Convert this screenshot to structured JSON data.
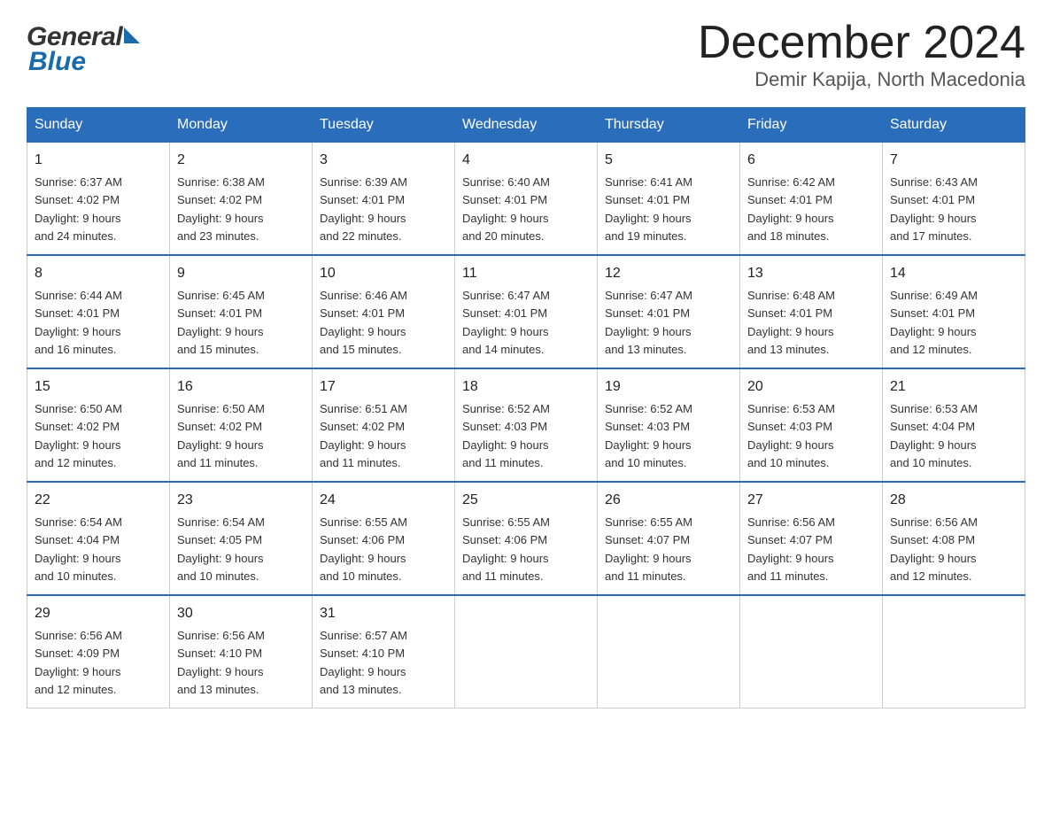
{
  "header": {
    "logo_general": "General",
    "logo_blue": "Blue",
    "month_year": "December 2024",
    "location": "Demir Kapija, North Macedonia"
  },
  "days_of_week": [
    "Sunday",
    "Monday",
    "Tuesday",
    "Wednesday",
    "Thursday",
    "Friday",
    "Saturday"
  ],
  "weeks": [
    [
      {
        "day": "1",
        "sunrise": "6:37 AM",
        "sunset": "4:02 PM",
        "daylight": "9 hours and 24 minutes."
      },
      {
        "day": "2",
        "sunrise": "6:38 AM",
        "sunset": "4:02 PM",
        "daylight": "9 hours and 23 minutes."
      },
      {
        "day": "3",
        "sunrise": "6:39 AM",
        "sunset": "4:01 PM",
        "daylight": "9 hours and 22 minutes."
      },
      {
        "day": "4",
        "sunrise": "6:40 AM",
        "sunset": "4:01 PM",
        "daylight": "9 hours and 20 minutes."
      },
      {
        "day": "5",
        "sunrise": "6:41 AM",
        "sunset": "4:01 PM",
        "daylight": "9 hours and 19 minutes."
      },
      {
        "day": "6",
        "sunrise": "6:42 AM",
        "sunset": "4:01 PM",
        "daylight": "9 hours and 18 minutes."
      },
      {
        "day": "7",
        "sunrise": "6:43 AM",
        "sunset": "4:01 PM",
        "daylight": "9 hours and 17 minutes."
      }
    ],
    [
      {
        "day": "8",
        "sunrise": "6:44 AM",
        "sunset": "4:01 PM",
        "daylight": "9 hours and 16 minutes."
      },
      {
        "day": "9",
        "sunrise": "6:45 AM",
        "sunset": "4:01 PM",
        "daylight": "9 hours and 15 minutes."
      },
      {
        "day": "10",
        "sunrise": "6:46 AM",
        "sunset": "4:01 PM",
        "daylight": "9 hours and 15 minutes."
      },
      {
        "day": "11",
        "sunrise": "6:47 AM",
        "sunset": "4:01 PM",
        "daylight": "9 hours and 14 minutes."
      },
      {
        "day": "12",
        "sunrise": "6:47 AM",
        "sunset": "4:01 PM",
        "daylight": "9 hours and 13 minutes."
      },
      {
        "day": "13",
        "sunrise": "6:48 AM",
        "sunset": "4:01 PM",
        "daylight": "9 hours and 13 minutes."
      },
      {
        "day": "14",
        "sunrise": "6:49 AM",
        "sunset": "4:01 PM",
        "daylight": "9 hours and 12 minutes."
      }
    ],
    [
      {
        "day": "15",
        "sunrise": "6:50 AM",
        "sunset": "4:02 PM",
        "daylight": "9 hours and 12 minutes."
      },
      {
        "day": "16",
        "sunrise": "6:50 AM",
        "sunset": "4:02 PM",
        "daylight": "9 hours and 11 minutes."
      },
      {
        "day": "17",
        "sunrise": "6:51 AM",
        "sunset": "4:02 PM",
        "daylight": "9 hours and 11 minutes."
      },
      {
        "day": "18",
        "sunrise": "6:52 AM",
        "sunset": "4:03 PM",
        "daylight": "9 hours and 11 minutes."
      },
      {
        "day": "19",
        "sunrise": "6:52 AM",
        "sunset": "4:03 PM",
        "daylight": "9 hours and 10 minutes."
      },
      {
        "day": "20",
        "sunrise": "6:53 AM",
        "sunset": "4:03 PM",
        "daylight": "9 hours and 10 minutes."
      },
      {
        "day": "21",
        "sunrise": "6:53 AM",
        "sunset": "4:04 PM",
        "daylight": "9 hours and 10 minutes."
      }
    ],
    [
      {
        "day": "22",
        "sunrise": "6:54 AM",
        "sunset": "4:04 PM",
        "daylight": "9 hours and 10 minutes."
      },
      {
        "day": "23",
        "sunrise": "6:54 AM",
        "sunset": "4:05 PM",
        "daylight": "9 hours and 10 minutes."
      },
      {
        "day": "24",
        "sunrise": "6:55 AM",
        "sunset": "4:06 PM",
        "daylight": "9 hours and 10 minutes."
      },
      {
        "day": "25",
        "sunrise": "6:55 AM",
        "sunset": "4:06 PM",
        "daylight": "9 hours and 11 minutes."
      },
      {
        "day": "26",
        "sunrise": "6:55 AM",
        "sunset": "4:07 PM",
        "daylight": "9 hours and 11 minutes."
      },
      {
        "day": "27",
        "sunrise": "6:56 AM",
        "sunset": "4:07 PM",
        "daylight": "9 hours and 11 minutes."
      },
      {
        "day": "28",
        "sunrise": "6:56 AM",
        "sunset": "4:08 PM",
        "daylight": "9 hours and 12 minutes."
      }
    ],
    [
      {
        "day": "29",
        "sunrise": "6:56 AM",
        "sunset": "4:09 PM",
        "daylight": "9 hours and 12 minutes."
      },
      {
        "day": "30",
        "sunrise": "6:56 AM",
        "sunset": "4:10 PM",
        "daylight": "9 hours and 13 minutes."
      },
      {
        "day": "31",
        "sunrise": "6:57 AM",
        "sunset": "4:10 PM",
        "daylight": "9 hours and 13 minutes."
      },
      null,
      null,
      null,
      null
    ]
  ],
  "labels": {
    "sunrise": "Sunrise:",
    "sunset": "Sunset:",
    "daylight": "Daylight:"
  }
}
